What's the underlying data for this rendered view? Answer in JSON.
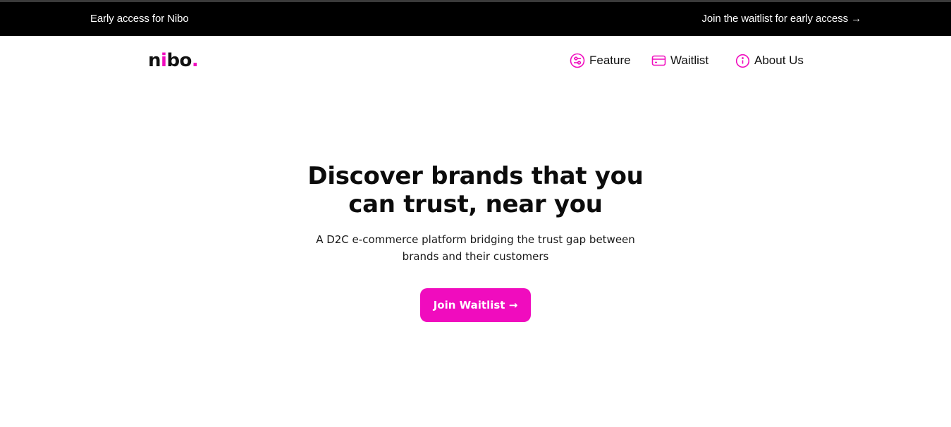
{
  "announcement": {
    "left_text": "Early access for Nibo",
    "right_link": "Join the waitlist for early access →"
  },
  "brand": {
    "logo_prefix": "n",
    "logo_accent_i": "i",
    "logo_suffix": "bo",
    "logo_dot": ".",
    "accent_color": "#f00cbe"
  },
  "nav": {
    "items": [
      {
        "label": "Feature",
        "icon": "sliders-icon"
      },
      {
        "label": "Waitlist",
        "icon": "card-icon"
      },
      {
        "label": "About Us",
        "icon": "info-icon"
      }
    ]
  },
  "hero": {
    "title": "Discover brands that you can trust, near you",
    "subtitle": "A D2C e-commerce platform bridging the trust gap between brands and their customers",
    "cta_label": "Join Waitlist →"
  }
}
